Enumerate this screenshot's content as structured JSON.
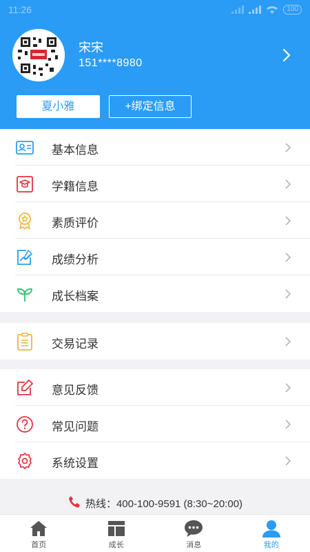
{
  "status_bar": {
    "time": "11:26",
    "battery": "100"
  },
  "profile": {
    "name": "宋宋",
    "phone": "151****8980"
  },
  "buttons": {
    "student": "夏小雅",
    "bind": "+绑定信息"
  },
  "menu_groups": [
    [
      {
        "label": "基本信息",
        "icon": "id-card-icon"
      },
      {
        "label": "学籍信息",
        "icon": "graduation-icon"
      },
      {
        "label": "素质评价",
        "icon": "medal-icon"
      },
      {
        "label": "成绩分析",
        "icon": "chart-icon"
      },
      {
        "label": "成长档案",
        "icon": "sprout-icon"
      }
    ],
    [
      {
        "label": "交易记录",
        "icon": "clipboard-icon"
      }
    ],
    [
      {
        "label": "意见反馈",
        "icon": "edit-icon"
      },
      {
        "label": "常见问题",
        "icon": "question-icon"
      },
      {
        "label": "系统设置",
        "icon": "gear-icon"
      }
    ]
  ],
  "hotline": "热线：400-100-9591 (8:30~20:00)",
  "bottom_nav": [
    {
      "label": "首页",
      "icon": "home-icon"
    },
    {
      "label": "成长",
      "icon": "layout-icon"
    },
    {
      "label": "消息",
      "icon": "chat-icon"
    },
    {
      "label": "我的",
      "icon": "user-icon",
      "active": true
    }
  ],
  "colors": {
    "primary": "#2a9cf5",
    "red": "#e5323f",
    "yellow": "#f2b63a",
    "green": "#2dbf6d",
    "info_blue": "#2a9cf5"
  }
}
